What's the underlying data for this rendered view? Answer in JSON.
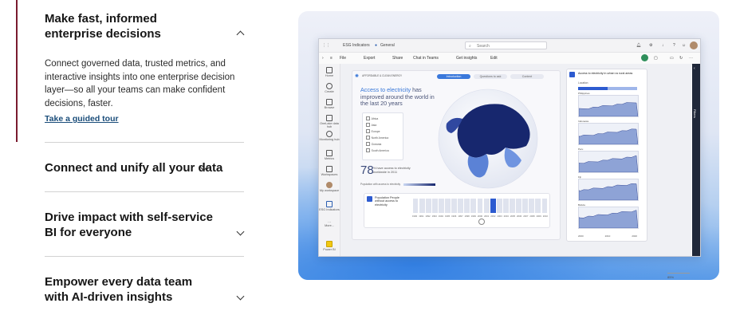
{
  "accordion": {
    "items": [
      {
        "title": "Make fast, informed enterprise decisions",
        "expanded": true,
        "body": "Connect governed data, trusted metrics, and interactive insights into one enterprise decision layer—so all your teams can make confident decisions, faster.",
        "link": "Take a guided tour"
      },
      {
        "title": "Connect and unify all your data",
        "expanded": false
      },
      {
        "title": "Drive impact with self-service BI for everyone",
        "expanded": false
      },
      {
        "title": "Empower every data team with AI-driven insights",
        "expanded": false
      }
    ]
  },
  "screenshot": {
    "titlebar": {
      "app": "ESG Indicators",
      "workspace": "General",
      "search": "Search"
    },
    "toolbar": [
      "File",
      "Export",
      "Share",
      "Chat in Teams",
      "Get insights",
      "Edit"
    ],
    "rail": [
      "Home",
      "Create",
      "Browse",
      "OneLake data hub",
      "Monitoring hub",
      "Metrics",
      "Workspaces",
      "My workspace",
      "ESG Indicators",
      "More...",
      "Power BI"
    ],
    "filters_label": "Filters",
    "report": {
      "header": "AFFORDABLE & CLEAN ENERGY",
      "tabs": [
        "Introduction",
        "Questions to ask",
        "Context"
      ],
      "title_hl": "Access to electricity",
      "title_rest": "has improved around the world in the last 20 years",
      "regions": [
        "Africa",
        "Asia",
        "Europe",
        "North America",
        "Oceania",
        "South America"
      ],
      "stat_value": "78",
      "stat_text": "% have access to electricity worldwide in 2011",
      "legend": "Population with access to electricity",
      "timeline_label": "Population People without access to electricity",
      "years": [
        "1990",
        "1991",
        "1992",
        "1993",
        "1994",
        "1995",
        "1996",
        "1997",
        "1998",
        "1999",
        "2000",
        "2001",
        "2002",
        "2003",
        "2004",
        "2005",
        "2006",
        "2007",
        "2008",
        "2009",
        "2010"
      ]
    },
    "side_panel": {
      "title": "Access to electricity in urban vs rural areas",
      "location": "Location",
      "sections": [
        "Philippines",
        "Indonesia",
        "Peru",
        "Fiji",
        "Bolivia"
      ],
      "years": [
        "2000",
        "2010",
        "2020"
      ]
    },
    "zoom": "85%"
  },
  "colors": {
    "accent_bar": "#7a1b2f",
    "link": "#1a4d7a",
    "map_dark": "#17276e",
    "map_light": "#5b82d6",
    "area_fill": "#8ea3d6",
    "area_stroke": "#3b4f9a"
  }
}
